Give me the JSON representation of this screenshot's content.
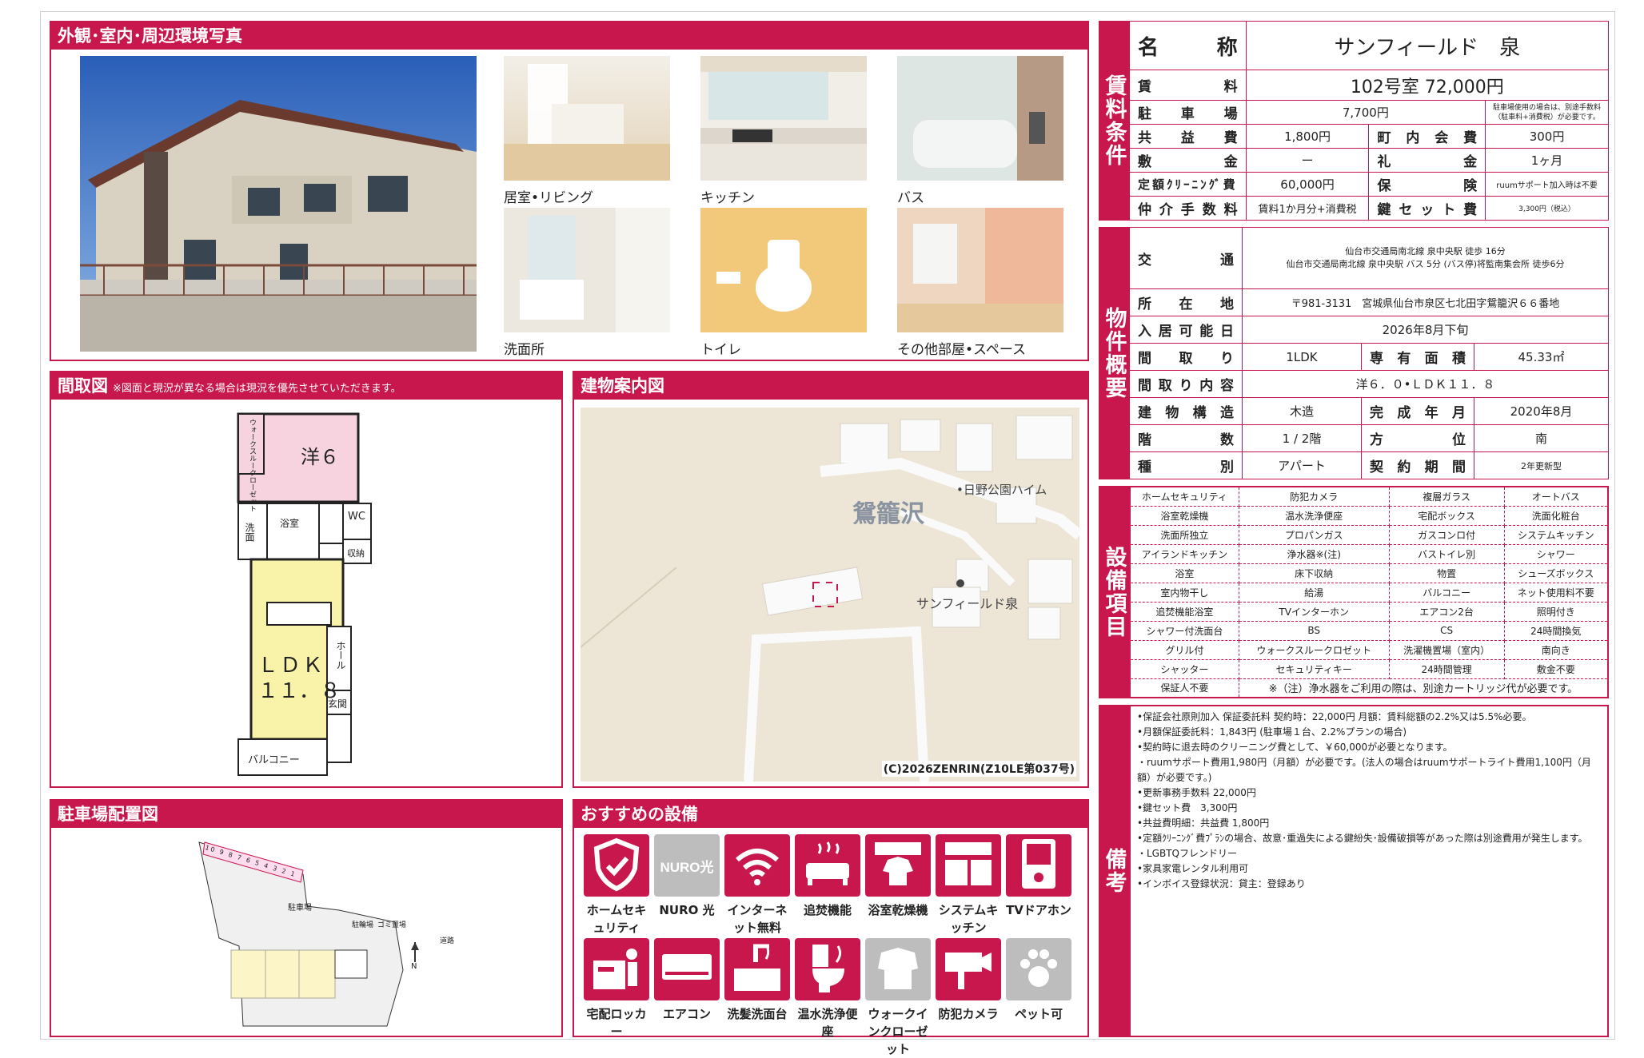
{
  "sections": {
    "photos_title": "外観･室内･周辺環境写真",
    "floorplan_title": "間取図",
    "floorplan_note": "※図面と現況が異なる場合は現況を優先させていただきます。",
    "map_title": "建物案内図",
    "parking_title": "駐車場配置図",
    "recommended_title": "おすすめの設備"
  },
  "photo_captions": [
    "居室•リビング",
    "キッチン",
    "バス",
    "洗面所",
    "トイレ",
    "その他部屋•スペース"
  ],
  "floorplan": {
    "room_yo": "洋６",
    "walkin": "ウォークスルークローゼット",
    "senmen": "洗面",
    "yokushitsu": "浴室",
    "wc": "WC",
    "shuno": "収納",
    "ldk": "ＬＤＫ",
    "ldk_size": "１１．８",
    "hall": "ホール",
    "genkan": "玄関",
    "balcony": "バルコニー"
  },
  "map": {
    "area": "鴛籠沢",
    "poi1": "•日野公園ハイム",
    "poi2": "サンフィールド泉",
    "copyright": "(C)2026ZENRIN(Z10LE第037号)"
  },
  "parking": {
    "nums": [
      "10",
      "9",
      "8",
      "7",
      "6",
      "5",
      "4",
      "3",
      "2",
      "1"
    ],
    "chushajo": "駐車場",
    "churinjo": "駐輪場",
    "gomi": "ゴミ置場",
    "doro": "道路",
    "north": "N"
  },
  "recommended": [
    {
      "label": "ホームセキュリティ",
      "icon": "shield-icon"
    },
    {
      "label": "NURO 光",
      "icon": "nuro-icon",
      "gray": true
    },
    {
      "label": "インターネット無料",
      "icon": "wifi-icon"
    },
    {
      "label": "追焚機能",
      "icon": "bathtub-icon"
    },
    {
      "label": "浴室乾燥機",
      "icon": "bath-dryer-icon"
    },
    {
      "label": "システムキッチン",
      "icon": "kitchen-icon"
    },
    {
      "label": "TVドアホン",
      "icon": "intercom-icon"
    },
    {
      "label": "宅配ロッカー",
      "icon": "locker-icon"
    },
    {
      "label": "エアコン",
      "icon": "aircon-icon"
    },
    {
      "label": "洗髪洗面台",
      "icon": "washbasin-icon"
    },
    {
      "label": "温水洗浄便座",
      "icon": "toilet-icon"
    },
    {
      "label": "ウォークインクローゼット",
      "icon": "closet-icon",
      "gray": true
    },
    {
      "label": "防犯カメラ",
      "icon": "camera-icon"
    },
    {
      "label": "ペット可",
      "icon": "paw-icon",
      "gray": true
    }
  ],
  "nuro_text": "NURO光",
  "side_labels": {
    "chinryo": "賃料条件",
    "bukken": "物件概要",
    "setsubi": "設備項目",
    "biko": "備考"
  },
  "rent": {
    "name_k": "名　称",
    "name_v": "サンフィールド　泉",
    "chinryo_k": "賃　料",
    "chinryo_v": "102号室 72,000円",
    "parking_k": "駐車場",
    "parking_v": "7,700円",
    "parking_note": "駐車場使用の場合は、別途手数料（駐車料+消費税）が必要です。",
    "kyoeki_k": "共益費",
    "kyoeki_v": "1,800円",
    "chonai_k": "町内会費",
    "chonai_v": "300円",
    "shiki_k": "敷金",
    "shiki_v": "ー",
    "rei_k": "礼金",
    "rei_v": "1ヶ月",
    "clean_k": "定額ｸﾘｰﾆﾝｸﾞ費",
    "clean_v": "60,000円",
    "hoken_k": "保険",
    "hoken_v": "ruumサポート加入時は不要",
    "chukai_k": "仲介手数料",
    "chukai_v": "賃料1か月分+消費税",
    "key_k": "鍵セット費",
    "key_v": "3,300円（税込）"
  },
  "gaiyo": {
    "kotsu_k": "交　通",
    "kotsu_v1": "仙台市交通局南北線 泉中央駅 徒歩 16分",
    "kotsu_v2": "仙台市交通局南北線 泉中央駅 バス 5分 (バス停)将監南集会所 徒歩6分",
    "shozai_k": "所在地",
    "shozai_v": "〒981-3131　宮城県仙台市泉区七北田字鴛籠沢６６番地",
    "nyukyo_k": "入居可能日",
    "nyukyo_v": "2026年8月下旬",
    "madori_k": "間　取　り",
    "madori_v": "1LDK",
    "menseki_k": "専有面積",
    "menseki_v": "45.33㎡",
    "naiyo_k": "間取り内容",
    "naiyo_v": "洋６．０•ＬＤＫ１１．８",
    "kozo_k": "建物構造",
    "kozo_v": "木造",
    "kansei_k": "完成年月",
    "kansei_v": "2020年8月",
    "kai_k": "階　数",
    "kai_v": "1 / 2階",
    "hoi_k": "方　位",
    "hoi_v": "南",
    "shubetsu_k": "種　別",
    "shubetsu_v": "アパート",
    "keiyaku_k": "契約期間",
    "keiyaku_v": "2年更新型"
  },
  "equipment": [
    [
      "ホームセキュリティ",
      "防犯カメラ",
      "複層ガラス",
      "オートバス"
    ],
    [
      "浴室乾燥機",
      "温水洗浄便座",
      "宅配ボックス",
      "洗面化粧台"
    ],
    [
      "洗面所独立",
      "プロパンガス",
      "ガスコンロ付",
      "システムキッチン"
    ],
    [
      "アイランドキッチン",
      "浄水器※(注)",
      "バストイレ別",
      "シャワー"
    ],
    [
      "浴室",
      "床下収納",
      "物置",
      "シューズボックス"
    ],
    [
      "室内物干し",
      "給湯",
      "バルコニー",
      "ネット使用料不要"
    ],
    [
      "追焚機能浴室",
      "TVインターホン",
      "エアコン2台",
      "照明付き"
    ],
    [
      "シャワー付洗面台",
      "BS",
      "CS",
      "24時間換気"
    ],
    [
      "グリル付",
      "ウォークスルークロゼット",
      "洗濯機置場（室内）",
      "南向き"
    ],
    [
      "シャッター",
      "セキュリティキー",
      "24時間管理",
      "敷金不要"
    ]
  ],
  "equipment_last": {
    "c1": "保証人不要",
    "note": "※（注）浄水器をご利用の際は、別途カートリッジ代が必要です。"
  },
  "remarks": [
    "•保証会社原則加入 保証委託料 契約時：22,000円 月額：賃料総額の2.2%又は5.5%必要。",
    "•月額保証委託料：1,843円 (駐車場１台、2.2%プランの場合)",
    "•契約時に退去時のクリーニング費として、￥60,000が必要となります。",
    "・ruumサポート費用1,980円（月額）が必要です。(法人の場合はruumサポートライト費用1,100円（月額）が必要です。)",
    "•更新事務手数料 22,000円",
    "•鍵セット費　3,300円",
    "•共益費明細：共益費 1,800円",
    "•定額ｸﾘｰﾆﾝｸﾞ費ﾌﾟﾗﾝの場合、故意･重過失による鍵紛失･設備破損等があった際は別途費用が発生します。",
    "・LGBTQフレンドリー",
    "•家具家電レンタル利用可",
    "•インボイス登録状況：貸主：登録あり"
  ],
  "colors": {
    "accent": "#c8174d"
  }
}
